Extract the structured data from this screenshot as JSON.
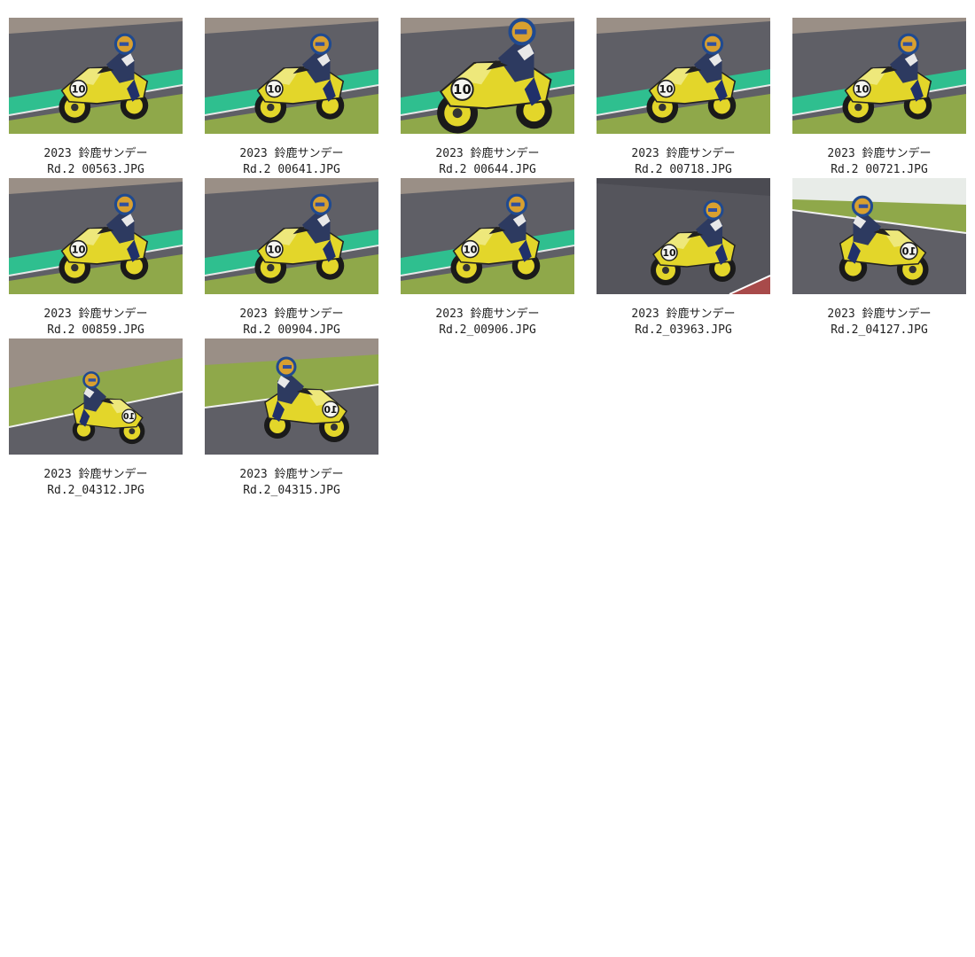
{
  "gallery": {
    "items": [
      {
        "line1": "2023 鈴鹿サンデー",
        "line2": "Rd.2 00563.JPG",
        "scene": "curb-green"
      },
      {
        "line1": "2023 鈴鹿サンデー",
        "line2": "Rd.2 00641.JPG",
        "scene": "curb-green"
      },
      {
        "line1": "2023 鈴鹿サンデー",
        "line2": "Rd.2 00644.JPG",
        "scene": "curb-green-close"
      },
      {
        "line1": "2023 鈴鹿サンデー",
        "line2": "Rd.2 00718.JPG",
        "scene": "curb-green"
      },
      {
        "line1": "2023 鈴鹿サンデー",
        "line2": "Rd.2 00721.JPG",
        "scene": "curb-green"
      },
      {
        "line1": "2023 鈴鹿サンデー",
        "line2": "Rd.2 00859.JPG",
        "scene": "curb-green"
      },
      {
        "line1": "2023 鈴鹿サンデー",
        "line2": "Rd.2 00904.JPG",
        "scene": "curb-green"
      },
      {
        "line1": "2023 鈴鹿サンデー",
        "line2": "Rd.2_00906.JPG",
        "scene": "curb-green"
      },
      {
        "line1": "2023 鈴鹿サンデー",
        "line2": "Rd.2_03963.JPG",
        "scene": "asphalt"
      },
      {
        "line1": "2023 鈴鹿サンデー",
        "line2": "Rd.2_04127.JPG",
        "scene": "grass-right"
      },
      {
        "line1": "2023 鈴鹿サンデー",
        "line2": "Rd.2_04312.JPG",
        "scene": "grass-far"
      },
      {
        "line1": "2023 鈴鹿サンデー",
        "line2": "Rd.2_04315.JPG",
        "scene": "grass-right-left"
      }
    ]
  },
  "colors": {
    "bike_yellow": "#e3d62a",
    "track_gray": "#5f5f66",
    "curb_green": "#2fbf8f",
    "grass": "#8fa84a"
  }
}
